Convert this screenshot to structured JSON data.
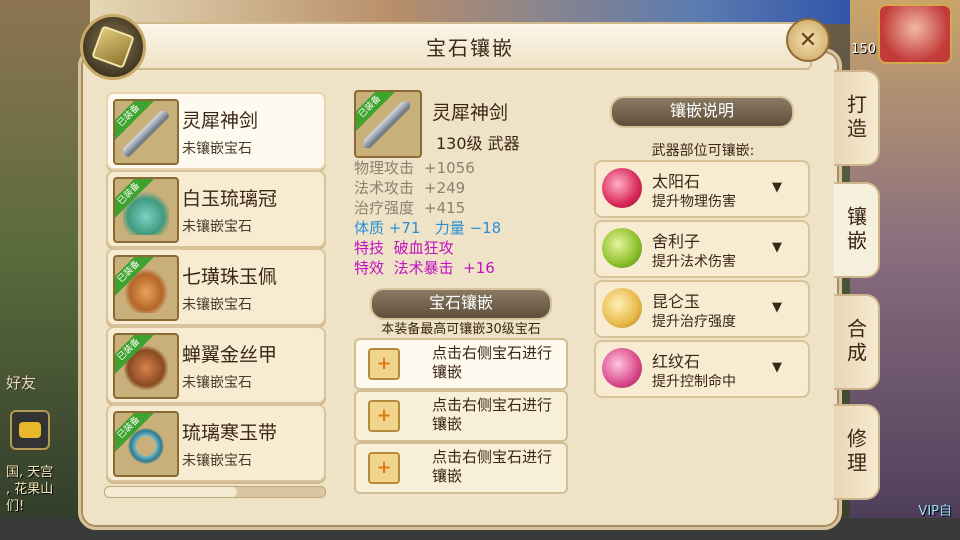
{
  "window": {
    "title": "宝石镶嵌"
  },
  "hud": {
    "friend_label": "好友",
    "chat_lines": [
      "国, 天宫",
      ", 花果山",
      "们!"
    ],
    "level_badge": "150",
    "vip_text": "VIP自"
  },
  "equipment": [
    {
      "name": "灵犀神剑",
      "status": "未镶嵌宝石",
      "badge": "已装备",
      "icon": "sword-icon",
      "selected": true
    },
    {
      "name": "白玉琉璃冠",
      "status": "未镶嵌宝石",
      "badge": "已装备",
      "icon": "crown-icon",
      "selected": false
    },
    {
      "name": "七璜珠玉佩",
      "status": "未镶嵌宝石",
      "badge": "已装备",
      "icon": "pendant-icon",
      "selected": false
    },
    {
      "name": "蝉翼金丝甲",
      "status": "未镶嵌宝石",
      "badge": "已装备",
      "icon": "armor-icon",
      "selected": false
    },
    {
      "name": "琉璃寒玉带",
      "status": "未镶嵌宝石",
      "badge": "已装备",
      "icon": "belt-icon",
      "selected": false
    }
  ],
  "detail": {
    "name": "灵犀神剑",
    "badge": "已装备",
    "level": "130级  武器",
    "attrs": [
      {
        "k": "物理攻击",
        "v": "+1056"
      },
      {
        "k": "法术攻击",
        "v": "+249"
      },
      {
        "k": "治疗强度",
        "v": "+415"
      }
    ],
    "stats_line": {
      "a_k": "体质",
      "a_v": "+71",
      "b_k": "力量",
      "b_v": "−18"
    },
    "skill_line": {
      "k": "特技",
      "v": "破血狂攻"
    },
    "effect_line": {
      "k": "特效",
      "v": "法术暴击",
      "extra": "+16"
    }
  },
  "gem_inlay": {
    "banner": "宝石镶嵌",
    "hint": "本装备最高可镶嵌30级宝石",
    "slots": [
      {
        "text": "点击右侧宝石进行镶嵌",
        "plus": "+"
      },
      {
        "text": "点击右侧宝石进行镶嵌",
        "plus": "+"
      },
      {
        "text": "点击右侧宝石进行镶嵌",
        "plus": "+"
      }
    ]
  },
  "inlay_desc": {
    "banner": "镶嵌说明",
    "subtitle": "武器部位可镶嵌:",
    "gems": [
      {
        "name": "太阳石",
        "effect": "提升物理伤害",
        "arrow": "▼",
        "color": "#d8285a"
      },
      {
        "name": "舍利子",
        "effect": "提升法术伤害",
        "arrow": "▼",
        "color": "#8bbf2a"
      },
      {
        "name": "昆仑玉",
        "effect": "提升治疗强度",
        "arrow": "▼",
        "color": "#e9b84a"
      },
      {
        "name": "红纹石",
        "effect": "提升控制命中",
        "arrow": "▼",
        "color": "#d94a8a"
      }
    ]
  },
  "tabs": [
    {
      "label": "打造",
      "active": false
    },
    {
      "label": "镶嵌",
      "active": true
    },
    {
      "label": "合成",
      "active": false
    },
    {
      "label": "修理",
      "active": false
    }
  ],
  "close_symbol": "✕"
}
